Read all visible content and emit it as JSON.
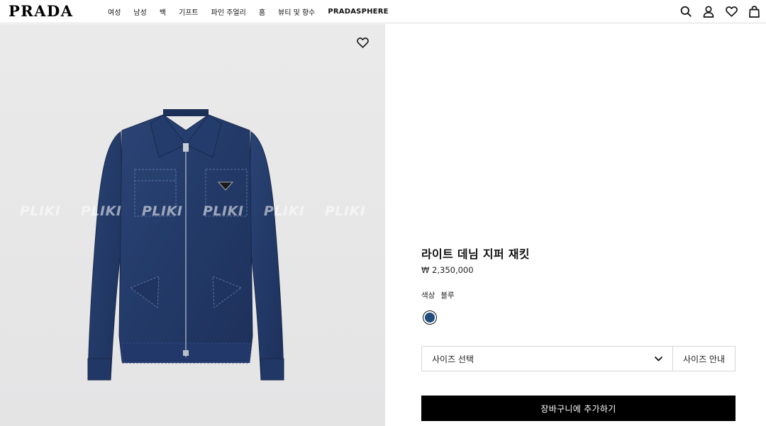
{
  "header": {
    "logo": "PRADA",
    "nav": [
      "여성",
      "남성",
      "백",
      "기프트",
      "파인 주얼리",
      "홈",
      "뷰티 및 향수",
      "PRADASPHERE"
    ],
    "icons": [
      "search-icon",
      "account-icon",
      "wishlist-icon",
      "bag-icon"
    ]
  },
  "image": {
    "watermark_text": "PLIKI",
    "wishlist_icon": "heart-icon",
    "background": "#e8e8e9",
    "jacket_color": "#243a66"
  },
  "product": {
    "title": "라이트 데님 지퍼 재킷",
    "price": "₩ 2,350,000",
    "color_label": "색상",
    "color_value": "블루",
    "swatch_color": "#1f4e7d",
    "size_select": "사이즈 선택",
    "size_guide": "사이즈 안내",
    "add_to_cart": "장바구니에 추가하기"
  }
}
